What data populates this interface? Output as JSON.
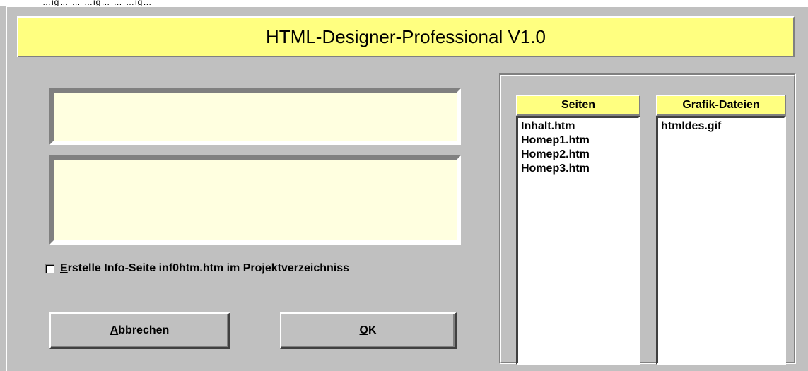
{
  "header_strip": {
    "partial_text": "…ig… … …ig… … …ig…"
  },
  "title": "HTML-Designer-Professional V1.0",
  "fields": {
    "field1_value": "",
    "field2_value": ""
  },
  "checkbox": {
    "label": "Erstelle Info-Seite inf0htm.htm im Projektverzeichniss",
    "checked": false
  },
  "buttons": {
    "cancel_label": "Abbrechen",
    "ok_label": "OK"
  },
  "lists": {
    "seiten": {
      "header": "Seiten",
      "items": [
        "Inhalt.htm",
        "Homep1.htm",
        "Homep2.htm",
        "Homep3.htm"
      ]
    },
    "grafik": {
      "header": "Grafik-Dateien",
      "items": [
        "htmldes.gif"
      ]
    }
  },
  "colors": {
    "background": "#c0c0c0",
    "title_banner": "#ffff80",
    "field_bg": "#ffffe0",
    "list_bg": "#ffffff"
  }
}
